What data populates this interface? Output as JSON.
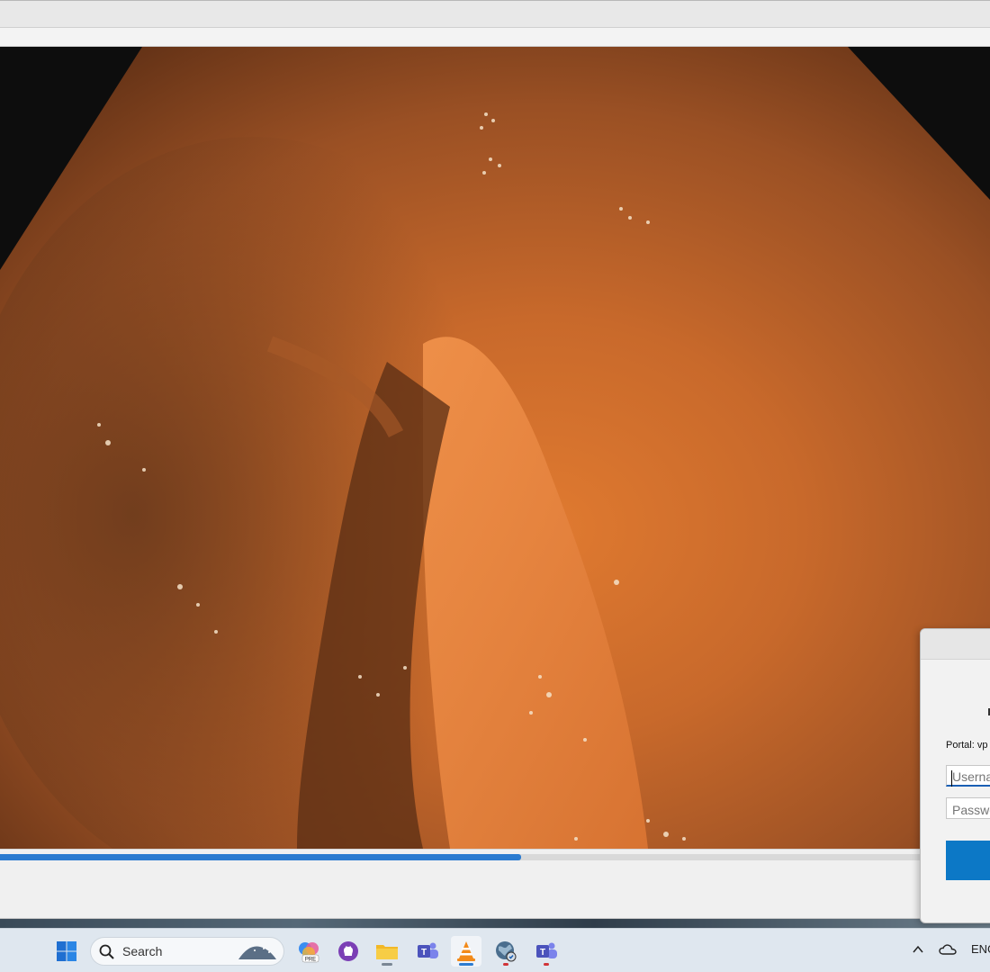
{
  "window": {
    "title_bar": "",
    "toolbar": ""
  },
  "video": {
    "content": "endoscopy video frame",
    "progress_fraction": 0.526
  },
  "dialog": {
    "portal_label": "Portal: vp",
    "username_placeholder": "Userna",
    "password_placeholder": "Passwo"
  },
  "taskbar": {
    "search_label": "Search",
    "apps": [
      {
        "name": "windows-start-icon"
      },
      {
        "name": "copilot-pre-icon"
      },
      {
        "name": "github-icon"
      },
      {
        "name": "file-explorer-icon"
      },
      {
        "name": "teams-icon"
      },
      {
        "name": "vlc-icon"
      },
      {
        "name": "vpn-globe-icon"
      },
      {
        "name": "teams-icon"
      }
    ],
    "tray_language": "ENG"
  },
  "colors": {
    "accent": "#2b7bd0",
    "dialog_button": "#0c78c6"
  }
}
